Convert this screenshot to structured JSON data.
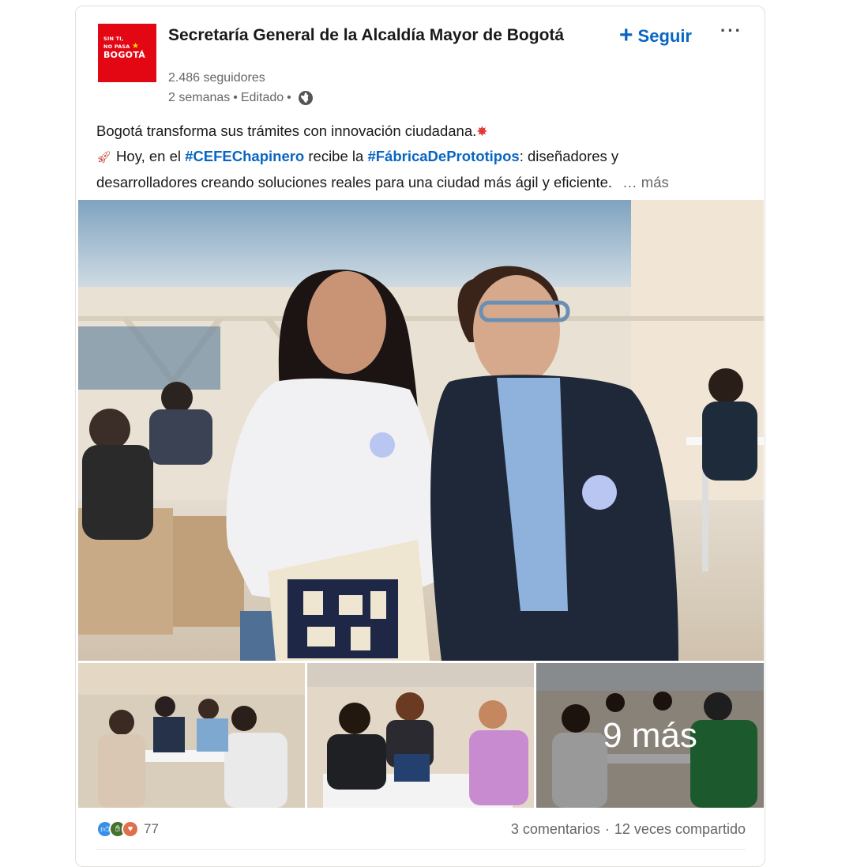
{
  "post": {
    "author": {
      "name": "Secretaría General de la Alcaldía Mayor de Bogotá",
      "followers": "2.486 seguidores",
      "time": "2 semanas",
      "edited": "Editado",
      "logo_line1": "SIN TI,",
      "logo_line2": "NO PASA",
      "logo_line3": "BOGOTÁ",
      "logo_color": "#e30613"
    },
    "follow_label": "Seguir",
    "more_icon": "ellipsis-icon",
    "text": {
      "line1": "Bogotá transforma sus trámites con innovación ciudadana.",
      "line2_prefix": "Hoy, en el",
      "hashtag1": "#CEFEChapinero",
      "line2_mid": "recibe la",
      "hashtag2": "#FábricaDePrototipos",
      "line2_suffix": ": diseñadores y",
      "line3": "desarrolladores creando soluciones reales para una ciudad más ágil y eficiente.",
      "see_more": "… más"
    },
    "images": {
      "more_overlay": "9 más"
    },
    "social": {
      "reaction_count": "77",
      "comments": "3 comentarios",
      "separator": "·",
      "shares": "12 veces compartido"
    },
    "colors": {
      "link": "#0a66c2",
      "secondary_text": "#666666"
    }
  }
}
